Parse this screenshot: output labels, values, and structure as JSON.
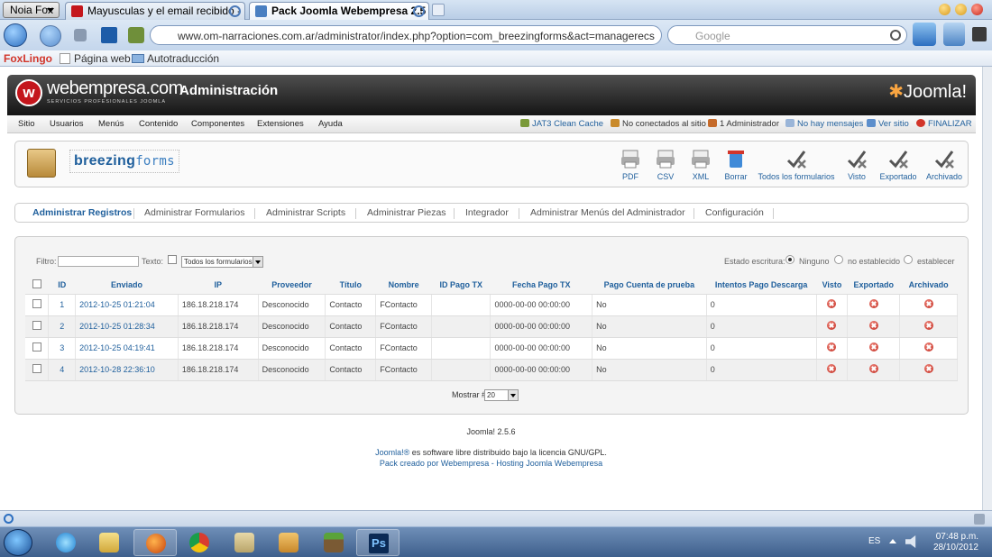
{
  "browser": {
    "menu_label": "Noia Fox",
    "tabs": [
      {
        "label": "Mayusculas y el email recibido - Ho...",
        "active": false
      },
      {
        "label": "Pack Joomla Webempresa 2.5 - A...",
        "active": true
      }
    ],
    "url": "www.om-narraciones.com.ar/administrator/index.php?option=com_breezingforms&act=managerecs",
    "search_placeholder": "Google",
    "bookmarks": {
      "foxlingo": "FoxLingo",
      "pagina_web": "Página web",
      "autotraduccion": "Autotraducción"
    }
  },
  "header": {
    "logo_text": "webempresa.com",
    "logo_sub": "SERVICIOS PROFESIONALES JOOMLA",
    "title": "Administración",
    "brand": "Joomla!"
  },
  "menu": {
    "items": [
      "Sitio",
      "Usuarios",
      "Menús",
      "Contenido",
      "Componentes",
      "Extensiones",
      "Ayuda"
    ],
    "status": {
      "cache": "JAT3 Clean Cache",
      "not_connected": "No conectados al sitio",
      "admins": "1 Administrador",
      "messages": "No hay mensajes",
      "view_site": "Ver sitio",
      "logout": "FINALIZAR"
    }
  },
  "component": {
    "logo_bold": "breezing",
    "logo_light": "forms",
    "toolbar": [
      "PDF",
      "CSV",
      "XML",
      "Borrar",
      "Todos los formularios",
      "Visto",
      "Exportado",
      "Archivado"
    ]
  },
  "subnav": {
    "items": [
      "Administrar Registros",
      "Administrar Formularios",
      "Administrar Scripts",
      "Administrar Piezas",
      "Integrador",
      "Administrar Menús del Administrador",
      "Configuración"
    ]
  },
  "filter": {
    "label": "Filtro:",
    "text_label": "Texto:",
    "form_select": "Todos los formularios",
    "state_label": "Estado escritura:",
    "state_options": [
      "Ninguno",
      "no establecido",
      "establecer"
    ],
    "state_selected": "Ninguno"
  },
  "table": {
    "headers": [
      "ID",
      "Enviado",
      "IP",
      "Proveedor",
      "Título",
      "Nombre",
      "ID Pago TX",
      "Fecha Pago TX",
      "Pago Cuenta de prueba",
      "Intentos Pago Descarga",
      "Visto",
      "Exportado",
      "Archivado"
    ],
    "rows": [
      {
        "id": "1",
        "enviado": "2012-10-25 01:21:04",
        "ip": "186.18.218.174",
        "proveedor": "Desconocido",
        "titulo": "Contacto",
        "nombre": "FContacto",
        "pago_tx": "",
        "fecha_pago": "0000-00-00 00:00:00",
        "prueba": "No",
        "intentos": "0"
      },
      {
        "id": "2",
        "enviado": "2012-10-25 01:28:34",
        "ip": "186.18.218.174",
        "proveedor": "Desconocido",
        "titulo": "Contacto",
        "nombre": "FContacto",
        "pago_tx": "",
        "fecha_pago": "0000-00-00 00:00:00",
        "prueba": "No",
        "intentos": "0"
      },
      {
        "id": "3",
        "enviado": "2012-10-25 04:19:41",
        "ip": "186.18.218.174",
        "proveedor": "Desconocido",
        "titulo": "Contacto",
        "nombre": "FContacto",
        "pago_tx": "",
        "fecha_pago": "0000-00-00 00:00:00",
        "prueba": "No",
        "intentos": "0"
      },
      {
        "id": "4",
        "enviado": "2012-10-28 22:36:10",
        "ip": "186.18.218.174",
        "proveedor": "Desconocido",
        "titulo": "Contacto",
        "nombre": "FContacto",
        "pago_tx": "",
        "fecha_pago": "0000-00-00 00:00:00",
        "prueba": "No",
        "intentos": "0"
      }
    ]
  },
  "pager": {
    "label": "Mostrar #",
    "value": "20"
  },
  "footer": {
    "version": "Joomla! 2.5.6",
    "license_link": "Joomla!®",
    "license_text": " es software libre distribuido bajo la licencia GNU/GPL.",
    "credits": "Pack creado por Webempresa - Hosting Joomla Webempresa"
  },
  "taskbar": {
    "lang": "ES",
    "time": "07:48 p.m.",
    "date": "28/10/2012"
  },
  "colors": {
    "link": "#1f5f9c",
    "header_dark": "#1a1a1a",
    "delete_red": "#c0261a",
    "taskbar": "#3e5f8c"
  }
}
